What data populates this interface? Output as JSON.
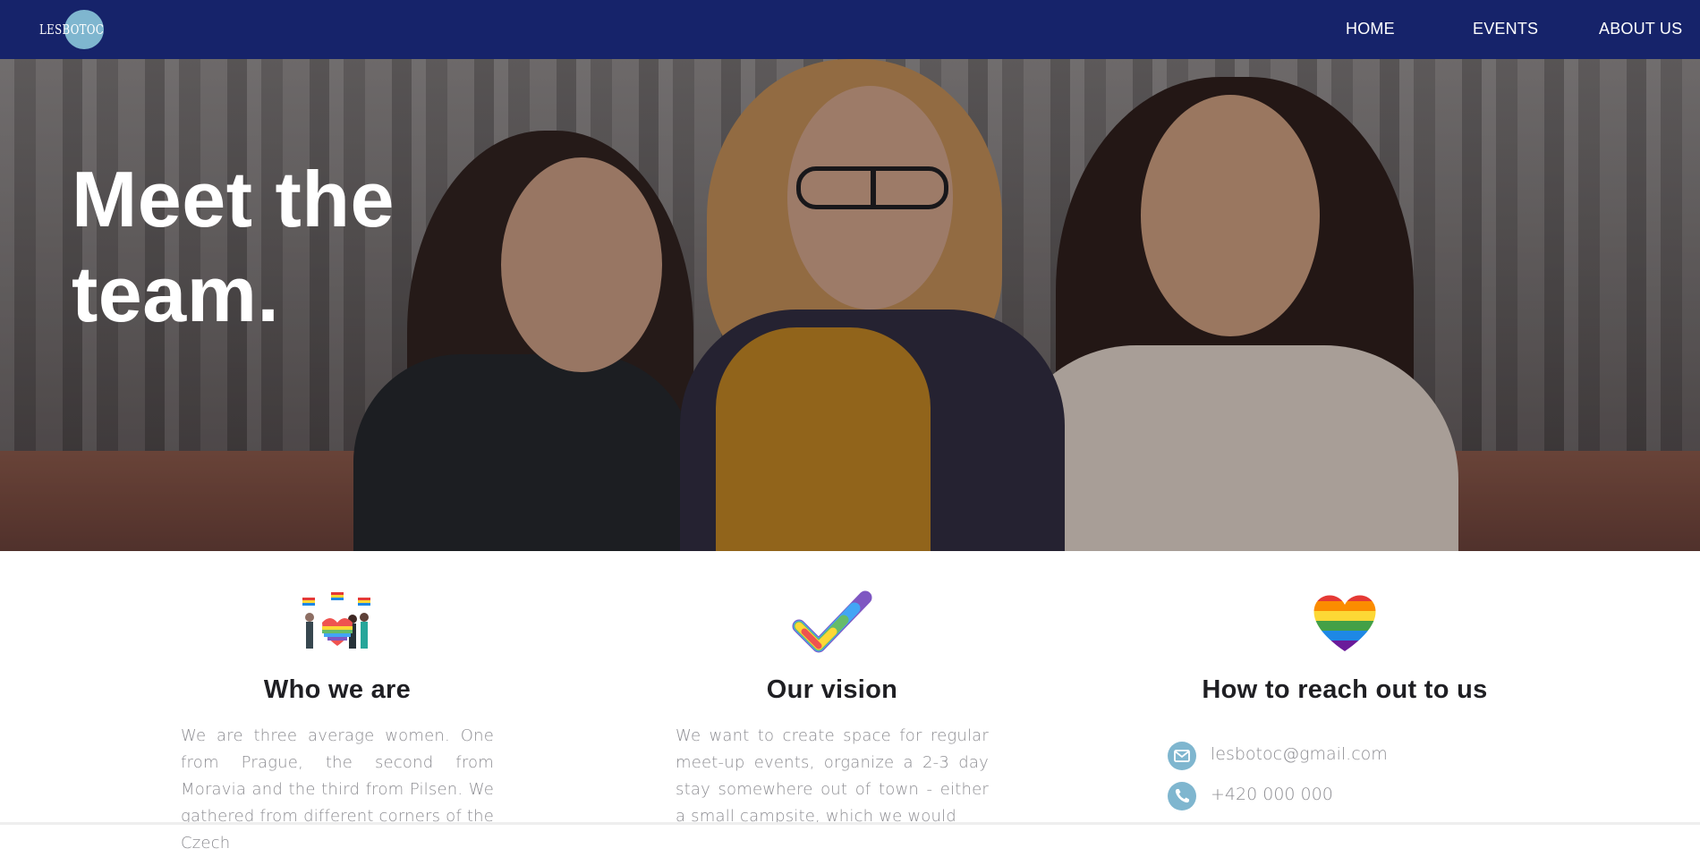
{
  "navbar": {
    "logo_text": "LESBOTOC",
    "links": [
      {
        "label": "HOME"
      },
      {
        "label": "EVENTS"
      },
      {
        "label": "ABOUT US"
      }
    ],
    "background_color": "#16236a"
  },
  "hero": {
    "title_line1": "Meet the",
    "title_line2": "team."
  },
  "sections": [
    {
      "icon": "pride-crowd-icon",
      "heading": "Who we are",
      "text": "We are three average women. One from Prague, the second from Moravia and the third from Pilsen. We gathered from different corners of the Czech"
    },
    {
      "icon": "rainbow-checkmark-icon",
      "heading": "Our vision",
      "text": "We want to create space for regular meet-up events, organize a 2-3 day stay somewhere out of town - either a small campsite, which we would"
    },
    {
      "icon": "rainbow-heart-icon",
      "heading": "How to reach out to us",
      "contacts": [
        {
          "icon": "mail-icon",
          "value": "lesbotoc@gmail.com"
        },
        {
          "icon": "phone-icon",
          "value": "+420 000 000"
        }
      ]
    }
  ],
  "colors": {
    "accent": "#7fb6cf",
    "nav": "#16236a",
    "body_text": "#8d8d92",
    "heading_text": "#1f1f23"
  }
}
